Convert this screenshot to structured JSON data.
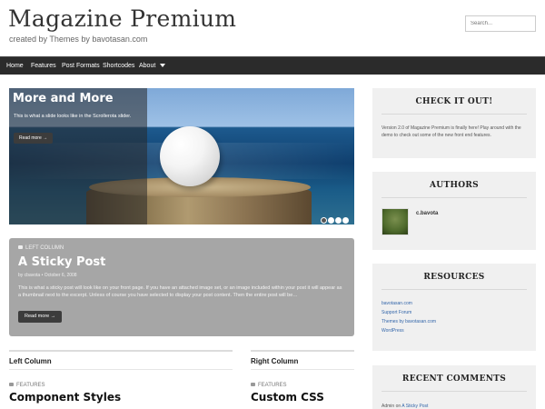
{
  "header": {
    "site_title": "Magazine Premium",
    "tagline": "created by Themes by bavotasan.com",
    "search_placeholder": "Search..."
  },
  "nav": {
    "items": [
      "Home",
      "Features",
      "Post Formats",
      "Shortcodes",
      "About"
    ]
  },
  "slider": {
    "title": "More and More",
    "text": "This is what a slide looks like in the Scrollerota slider.",
    "read_more": "Read more →",
    "slide_count": 4,
    "active_slide": 1
  },
  "sticky": {
    "category": "Left Column",
    "title": "A Sticky Post",
    "meta": "by cbavota • October 6, 2008",
    "excerpt": "This is what a sticky post will look like on your front page. If you have an attached image set, or an image included within your post it will appear as a thumbnail next to the excerpt. Unless of course you have selected to display your post content. Then the entire post will be…",
    "read_more": "Read more →"
  },
  "columns": {
    "left": {
      "heading": "Left Column",
      "category": "Features",
      "post_title": "Component Styles"
    },
    "right": {
      "heading": "Right Column",
      "category": "Features",
      "post_title": "Custom CSS"
    }
  },
  "sidebar": {
    "check_it_out": {
      "title": "CHECK IT OUT!",
      "text": "Version 2.0 of Magazine Premium is finally here! Play around with the demo to check out some of the new front end features."
    },
    "authors": {
      "title": "AUTHORS",
      "name": "c.bavota"
    },
    "resources": {
      "title": "RESOURCES",
      "links": [
        "bavotasan.com",
        "Support Forum",
        "Themes by bavotasan.com",
        "WordPress"
      ]
    },
    "recent_comments": {
      "title": "RECENT COMMENTS",
      "comment_author": "Admin",
      "comment_on": "on",
      "comment_post": "A Sticky Post"
    }
  },
  "colors": {
    "nav_bg": "#2b2b2b",
    "sticky_bg": "#a6a6a6",
    "widget_bg": "#f0f0f0",
    "link": "#3366aa"
  }
}
